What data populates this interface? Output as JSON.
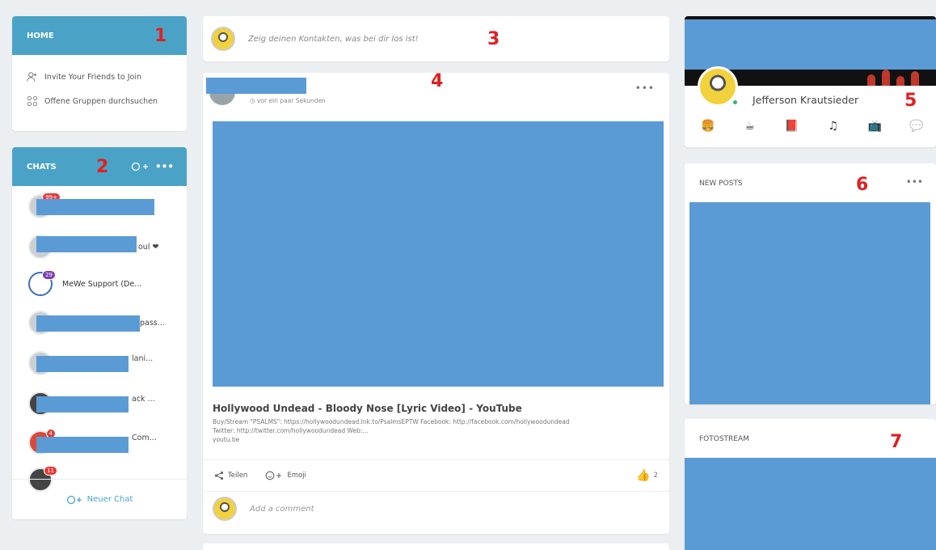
{
  "home": {
    "title": "HOME",
    "links": [
      {
        "label": "Invite Your Friends to Join",
        "icon": "add-person-icon"
      },
      {
        "label": "Offene Gruppen durchsuchen",
        "icon": "groups-icon"
      }
    ]
  },
  "chats": {
    "title": "CHATS",
    "more": "•••",
    "items": [
      {
        "badge": "99+",
        "suffix": "",
        "style": "light"
      },
      {
        "badge": "",
        "suffix": "oul ❤",
        "style": "light"
      },
      {
        "badge": "29",
        "name": "MeWe Support (De...",
        "style": "mewe"
      },
      {
        "badge": "",
        "suffix": "pass...",
        "style": "light"
      },
      {
        "badge": "",
        "suffix": "lani...",
        "style": "light"
      },
      {
        "badge": "",
        "suffix": "ack ...",
        "style": "dark"
      },
      {
        "badge": "4",
        "suffix": "Com...",
        "style": "red"
      },
      {
        "badge": "11",
        "suffix": "",
        "style": "dark"
      }
    ],
    "new_chat": "Neuer Chat"
  },
  "composer": {
    "placeholder": "Zeig deinen Kontakten, was bei dir los ist!"
  },
  "post": {
    "time": "vor ein paar Sekunden",
    "more": "•••",
    "link_title": "Hollywood Undead - Bloody Nose [Lyric Video] - YouTube",
    "link_desc": "Buy/Stream \"PSALMS\": https://hollywoodundead.lnk.to/PsalmsEPTW Facebook: http://facebook.com/hollywoodundead Twitter: http://twitter.com/hollywoodundead Web:...",
    "link_domain": "youtu.be",
    "share": "Teilen",
    "emoji": "Emoji",
    "likes": "2",
    "comment_placeholder": "Add a comment"
  },
  "profile": {
    "name": "Jefferson Krautsieder",
    "icons": [
      "🍔",
      "☕",
      "📕",
      "♫",
      "📺",
      "💬"
    ]
  },
  "new_posts": {
    "title": "NEW POSTS",
    "more": "•••"
  },
  "fotostream": {
    "title": "FOTOSTREAM"
  },
  "markers": [
    "1",
    "2",
    "3",
    "4",
    "5",
    "6",
    "7"
  ],
  "colors": {
    "header_blue": "#4aa3c6",
    "redaction_blue": "#5b9bd5",
    "marker_red": "#e02020",
    "online_green": "#3cb371"
  }
}
